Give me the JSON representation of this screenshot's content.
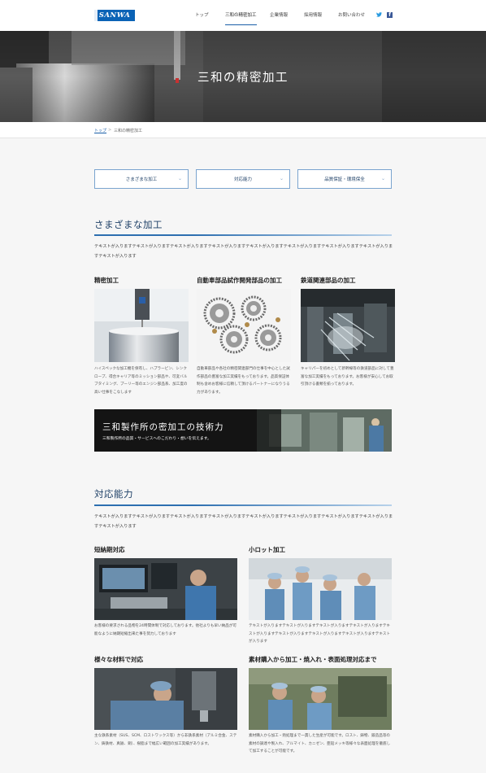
{
  "header": {
    "logo": "SANWA",
    "nav": [
      "トップ",
      "三和の精密加工",
      "企業情報",
      "採用情報",
      "お問い合わせ"
    ],
    "active_nav": "三和の精密加工",
    "social": [
      "twitter-icon",
      "facebook-icon"
    ],
    "facebook_glyph": "f",
    "twitter_glyph": "🐦"
  },
  "hero": {
    "title": "三和の精密加工"
  },
  "breadcrumb": {
    "home": "トップ",
    "separator": ">",
    "current": "三和の精密加工"
  },
  "tabs": [
    {
      "label": "さまざまな加工",
      "chevron": "⌄"
    },
    {
      "label": "対応能力",
      "chevron": "⌄"
    },
    {
      "label": "品質保証・環境保全",
      "chevron": "⌄"
    }
  ],
  "section1": {
    "heading": "さまざまな加工",
    "text": "テキストが入りますテキストが入りますテキストが入りますテキストが入りますテキストが入りますテキストが入りますテキストが入りますテキストが入りますテキストが入ります",
    "cards": [
      {
        "title": "精密加工",
        "text": "ハイスペックな加工機を保有し、ハプラービン、シンクロープ、得合キャリア等のミッション部品や、可変バルブタイミング、プーリー等のエンジン部品系、加工度の高い仕事をこなします"
      },
      {
        "title": "自動車部品試作開発部品の加工",
        "text": "自動車部品や各社の精密関連部門の仕事を中心とした試作部品の豊富な加工実績をもっております。品質保証体制も含めお客様に信頼して頂けるパートナーになりうる力があります。"
      },
      {
        "title": "鉄道関連部品の加工",
        "text": "キャリパーを初めとして新幹線等の鉄道部品に対して豊富な加工実績をもっております。お客様が安心してお取引頂ける書類を揃っております。"
      }
    ]
  },
  "banner": {
    "title": "三和製作所の密加工の技術力",
    "subtitle": "三和製作所の品質・サービスへのこだわり・想いを伝えます。"
  },
  "section2": {
    "heading": "対応能力",
    "text": "テキストが入りますテキストが入りますテキストが入りますテキストが入りますテキストが入りますテキストが入りますテキストが入りますテキストが入りますテキストが入ります",
    "cards": [
      {
        "title": "短納期対応",
        "text": "お客様の要求される品物を24時間体制で対応しております。他社よりも早い納品が可能なように納期短縮出来た事を努力しております"
      },
      {
        "title": "小ロット加工",
        "text": "テキストが入りますテキストが入りますテキストが入りますテキストが入りますテキストが入りますテキストが入りますテキストが入りますテキストが入りますテキストが入ります"
      },
      {
        "title": "様々な材料で対応",
        "text": "主な鉄系素材（SUS、SCM、ロストワックス等）から非鉄系素材（アルミ合金、ステン、鋳鉄材、真鍮、銅）、樹脂まで幅広い範囲の加工実績があります。"
      },
      {
        "title": "素材購入から加工・焼入れ・表面処理対応まで",
        "text": "素材購入から加工・熱処理まで一貫した生産が可能です。ロスト、鋳物、鍛造品等の素材の調達や製入れ、アルマイト、カニゼン、亜鉛メッキ等様々な表面処理を徹底して加工することが可能です。"
      }
    ]
  }
}
